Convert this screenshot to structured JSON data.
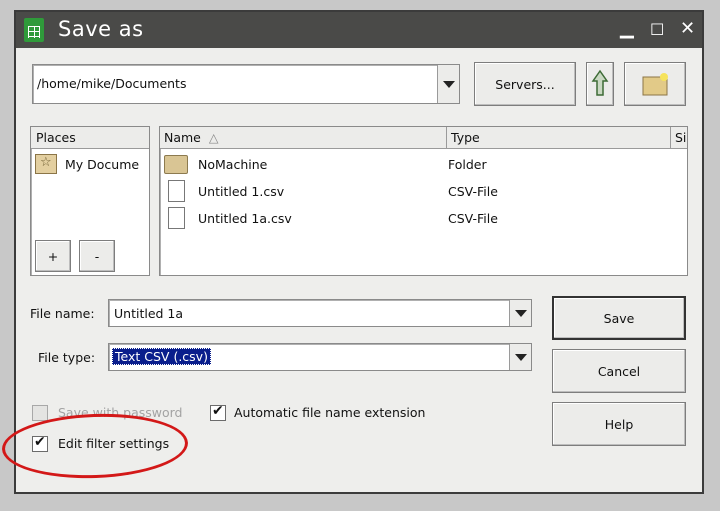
{
  "window": {
    "title": "Save as",
    "controls": {
      "minimize": "▁",
      "maximize": "☐",
      "close": "✕"
    }
  },
  "path": {
    "value": "/home/mike/Documents"
  },
  "toolbar": {
    "servers_label": "Servers...",
    "up_icon": "up-folder-icon",
    "new_folder_icon": "new-folder-icon"
  },
  "places": {
    "header": "Places",
    "items": [
      {
        "label": "My Docume",
        "icon": "favorite-folder-icon"
      }
    ],
    "add_label": "+",
    "remove_label": "-"
  },
  "files": {
    "columns": [
      "Name",
      "Type",
      "Si"
    ],
    "sort_indicator": "△",
    "rows": [
      {
        "name": "NoMachine",
        "type": "Folder",
        "icon": "folder-icon"
      },
      {
        "name": "Untitled 1.csv",
        "type": "CSV-File",
        "icon": "document-icon"
      },
      {
        "name": "Untitled 1a.csv",
        "type": "CSV-File",
        "icon": "document-icon"
      }
    ]
  },
  "form": {
    "file_name_label": "File name:",
    "file_name_value": "Untitled 1a",
    "file_type_label": "File type:",
    "file_type_value": "Text CSV (.csv)"
  },
  "options": {
    "password_label": "Save with password",
    "password_checked": false,
    "password_enabled": false,
    "auto_ext_label": "Automatic file name extension",
    "auto_ext_checked": true,
    "filter_label": "Edit filter settings",
    "filter_checked": true
  },
  "buttons": {
    "save": "Save",
    "cancel": "Cancel",
    "help": "Help"
  },
  "colors": {
    "titlebar": "#4a4a48",
    "selection": "#0a1e8c",
    "annotation": "#d31818",
    "app_icon": "#2f9a3a"
  }
}
